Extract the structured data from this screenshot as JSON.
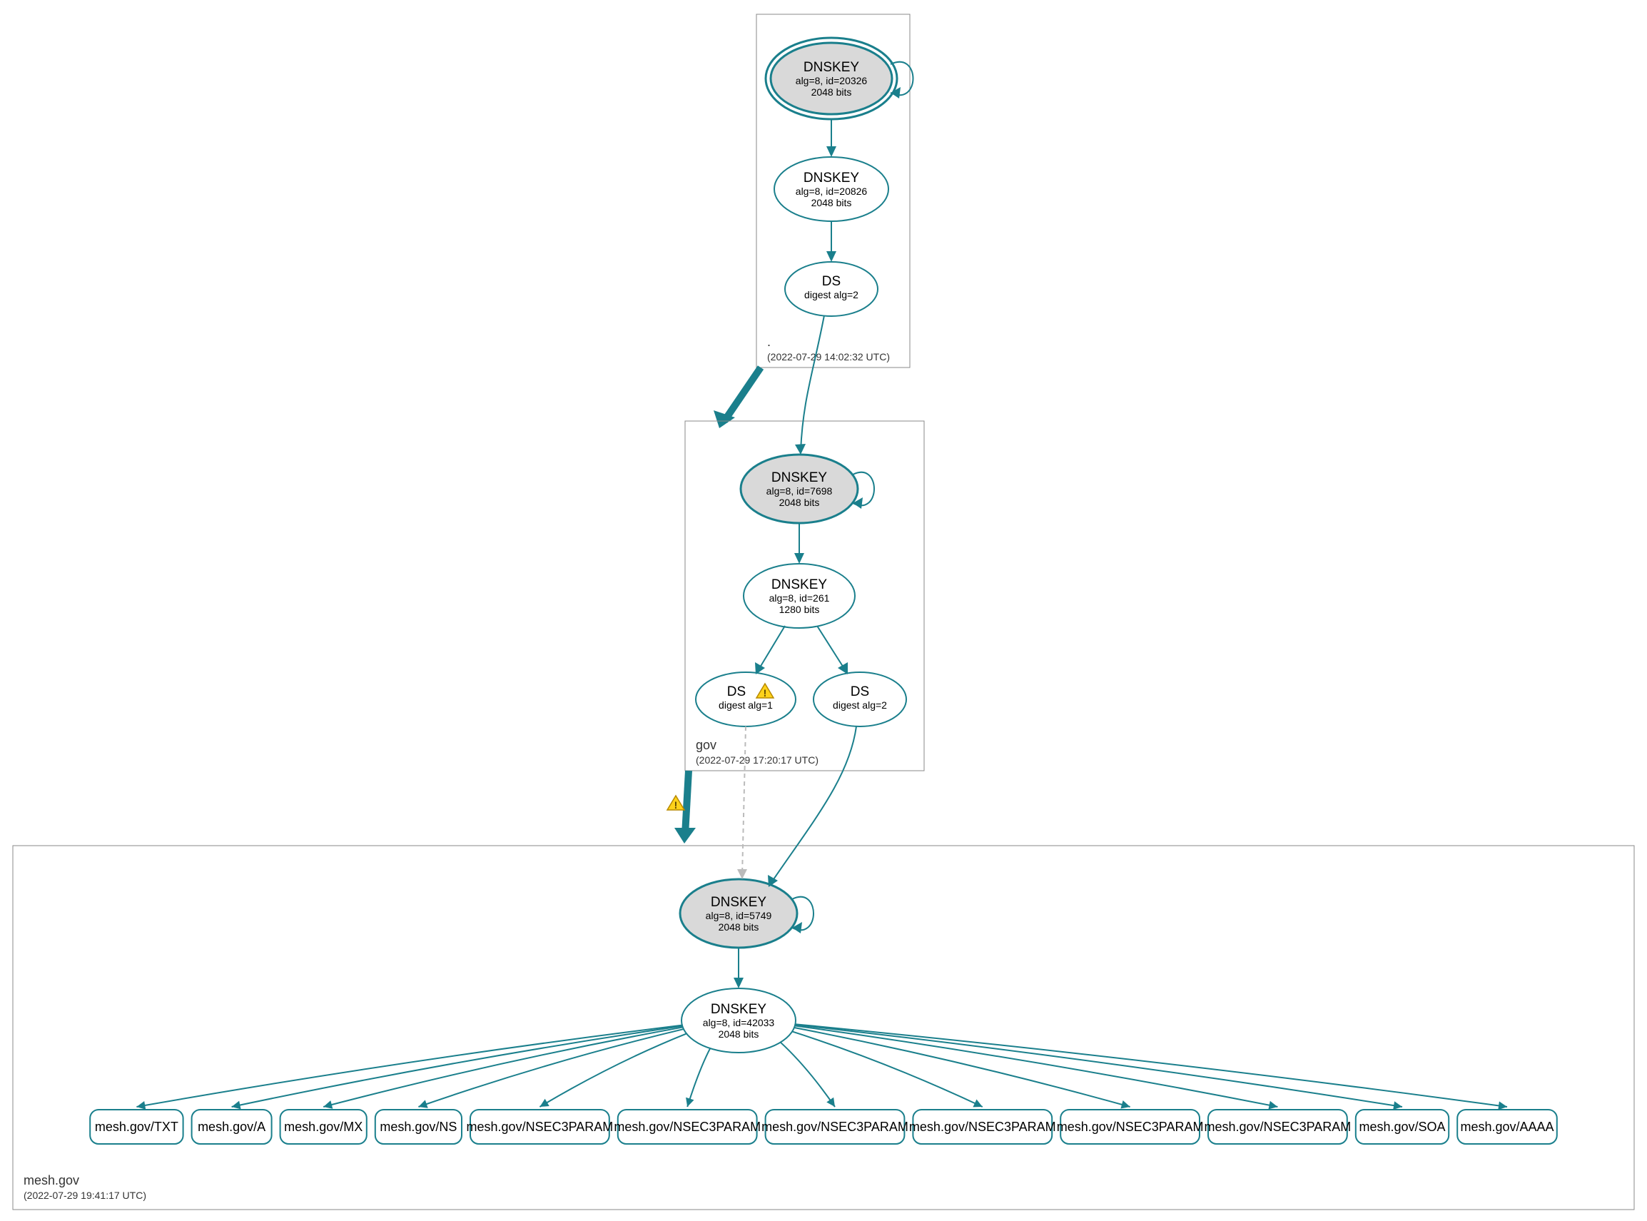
{
  "colors": {
    "stroke": "#1a7f8c",
    "ksk_fill": "#d9d9d9"
  },
  "zones": {
    "root": {
      "label": ".",
      "timestamp": "(2022-07-29 14:02:32 UTC)",
      "ksk": {
        "title": "DNSKEY",
        "line1": "alg=8, id=20326",
        "line2": "2048 bits"
      },
      "zsk": {
        "title": "DNSKEY",
        "line1": "alg=8, id=20826",
        "line2": "2048 bits"
      },
      "ds": {
        "title": "DS",
        "line1": "digest alg=2"
      }
    },
    "gov": {
      "label": "gov",
      "timestamp": "(2022-07-29 17:20:17 UTC)",
      "ksk": {
        "title": "DNSKEY",
        "line1": "alg=8, id=7698",
        "line2": "2048 bits"
      },
      "zsk": {
        "title": "DNSKEY",
        "line1": "alg=8, id=261",
        "line2": "1280 bits"
      },
      "ds1": {
        "title": "DS",
        "line1": "digest alg=1"
      },
      "ds2": {
        "title": "DS",
        "line1": "digest alg=2"
      }
    },
    "mesh": {
      "label": "mesh.gov",
      "timestamp": "(2022-07-29 19:41:17 UTC)",
      "ksk": {
        "title": "DNSKEY",
        "line1": "alg=8, id=5749",
        "line2": "2048 bits"
      },
      "zsk": {
        "title": "DNSKEY",
        "line1": "alg=8, id=42033",
        "line2": "2048 bits"
      }
    }
  },
  "rrsets": [
    "mesh.gov/TXT",
    "mesh.gov/A",
    "mesh.gov/MX",
    "mesh.gov/NS",
    "mesh.gov/NSEC3PARAM",
    "mesh.gov/NSEC3PARAM",
    "mesh.gov/NSEC3PARAM",
    "mesh.gov/NSEC3PARAM",
    "mesh.gov/NSEC3PARAM",
    "mesh.gov/NSEC3PARAM",
    "mesh.gov/SOA",
    "mesh.gov/AAAA"
  ]
}
